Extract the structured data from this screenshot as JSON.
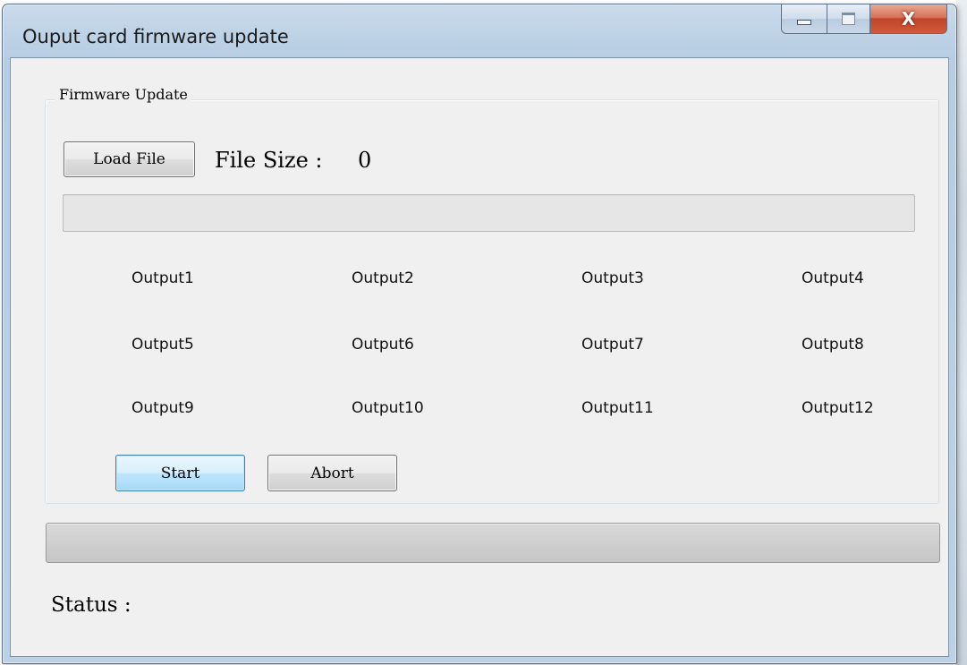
{
  "window": {
    "title": "Ouput card firmware update",
    "close_glyph": "X"
  },
  "group": {
    "legend": "Firmware Update"
  },
  "file": {
    "load_label": "Load File",
    "size_label": "File Size :",
    "size_value": "0",
    "progress": 0
  },
  "outputs": [
    "Output1",
    "Output2",
    "Output3",
    "Output4",
    "Output5",
    "Output6",
    "Output7",
    "Output8",
    "Output9",
    "Output10",
    "Output11",
    "Output12"
  ],
  "actions": {
    "start_label": "Start",
    "abort_label": "Abort"
  },
  "overall_progress": 0,
  "status": {
    "label": "Status :"
  },
  "icons": {
    "minimize": "minimize-icon",
    "maximize": "maximize-icon",
    "close": "close-icon"
  },
  "colors": {
    "client_bg": "#f0f0f0",
    "frame": "#bcd1e6",
    "close_button": "#c0462b",
    "start_focus_border": "#3c7fb1"
  }
}
